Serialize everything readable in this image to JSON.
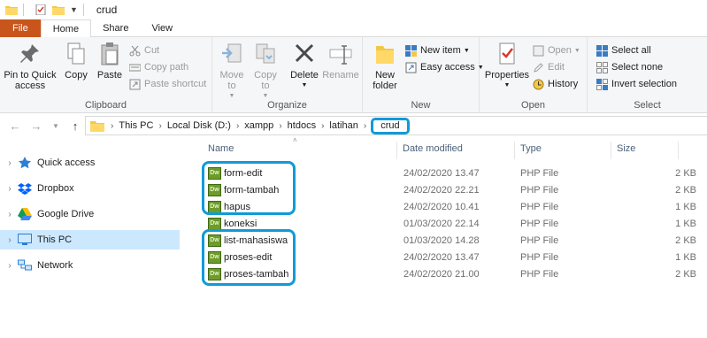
{
  "window": {
    "title": "crud"
  },
  "tabs": [
    "File",
    "Home",
    "Share",
    "View"
  ],
  "ribbon": {
    "clipboard": {
      "label": "Clipboard",
      "pin": "Pin to Quick access",
      "copy": "Copy",
      "paste": "Paste",
      "cut": "Cut",
      "copy_path": "Copy path",
      "paste_shortcut": "Paste shortcut"
    },
    "organize": {
      "label": "Organize",
      "move_to": "Move to",
      "copy_to": "Copy to",
      "delete": "Delete",
      "rename": "Rename"
    },
    "new": {
      "label": "New",
      "new_folder": "New folder",
      "new_item": "New item",
      "easy_access": "Easy access"
    },
    "open": {
      "label": "Open",
      "properties": "Properties",
      "open": "Open",
      "edit": "Edit",
      "history": "History"
    },
    "select": {
      "label": "Select",
      "select_all": "Select all",
      "select_none": "Select none",
      "invert": "Invert selection"
    }
  },
  "breadcrumb": [
    "This PC",
    "Local Disk (D:)",
    "xampp",
    "htdocs",
    "latihan",
    "crud"
  ],
  "nav": [
    {
      "label": "Quick access",
      "icon": "star-icon",
      "selected": false
    },
    {
      "label": "Dropbox",
      "icon": "dropbox-icon",
      "selected": false
    },
    {
      "label": "Google Drive",
      "icon": "google-drive-icon",
      "selected": false
    },
    {
      "label": "This PC",
      "icon": "computer-icon",
      "selected": true
    },
    {
      "label": "Network",
      "icon": "network-icon",
      "selected": false
    }
  ],
  "columns": {
    "name": "Name",
    "date": "Date modified",
    "type": "Type",
    "size": "Size"
  },
  "files": [
    {
      "name": "form-edit",
      "date": "24/02/2020 13.47",
      "type": "PHP File",
      "size": "2 KB"
    },
    {
      "name": "form-tambah",
      "date": "24/02/2020 22.21",
      "type": "PHP File",
      "size": "2 KB"
    },
    {
      "name": "hapus",
      "date": "24/02/2020 10.41",
      "type": "PHP File",
      "size": "1 KB"
    },
    {
      "name": "koneksi",
      "date": "01/03/2020 22.14",
      "type": "PHP File",
      "size": "1 KB"
    },
    {
      "name": "list-mahasiswa",
      "date": "01/03/2020 14.28",
      "type": "PHP File",
      "size": "2 KB"
    },
    {
      "name": "proses-edit",
      "date": "24/02/2020 13.47",
      "type": "PHP File",
      "size": "1 KB"
    },
    {
      "name": "proses-tambah",
      "date": "24/02/2020 21.00",
      "type": "PHP File",
      "size": "2 KB"
    }
  ],
  "file_icon_text": "Dw",
  "colors": {
    "file_tab": "#c8551c",
    "highlight": "#0f9bd7",
    "selection": "#cce8ff"
  }
}
